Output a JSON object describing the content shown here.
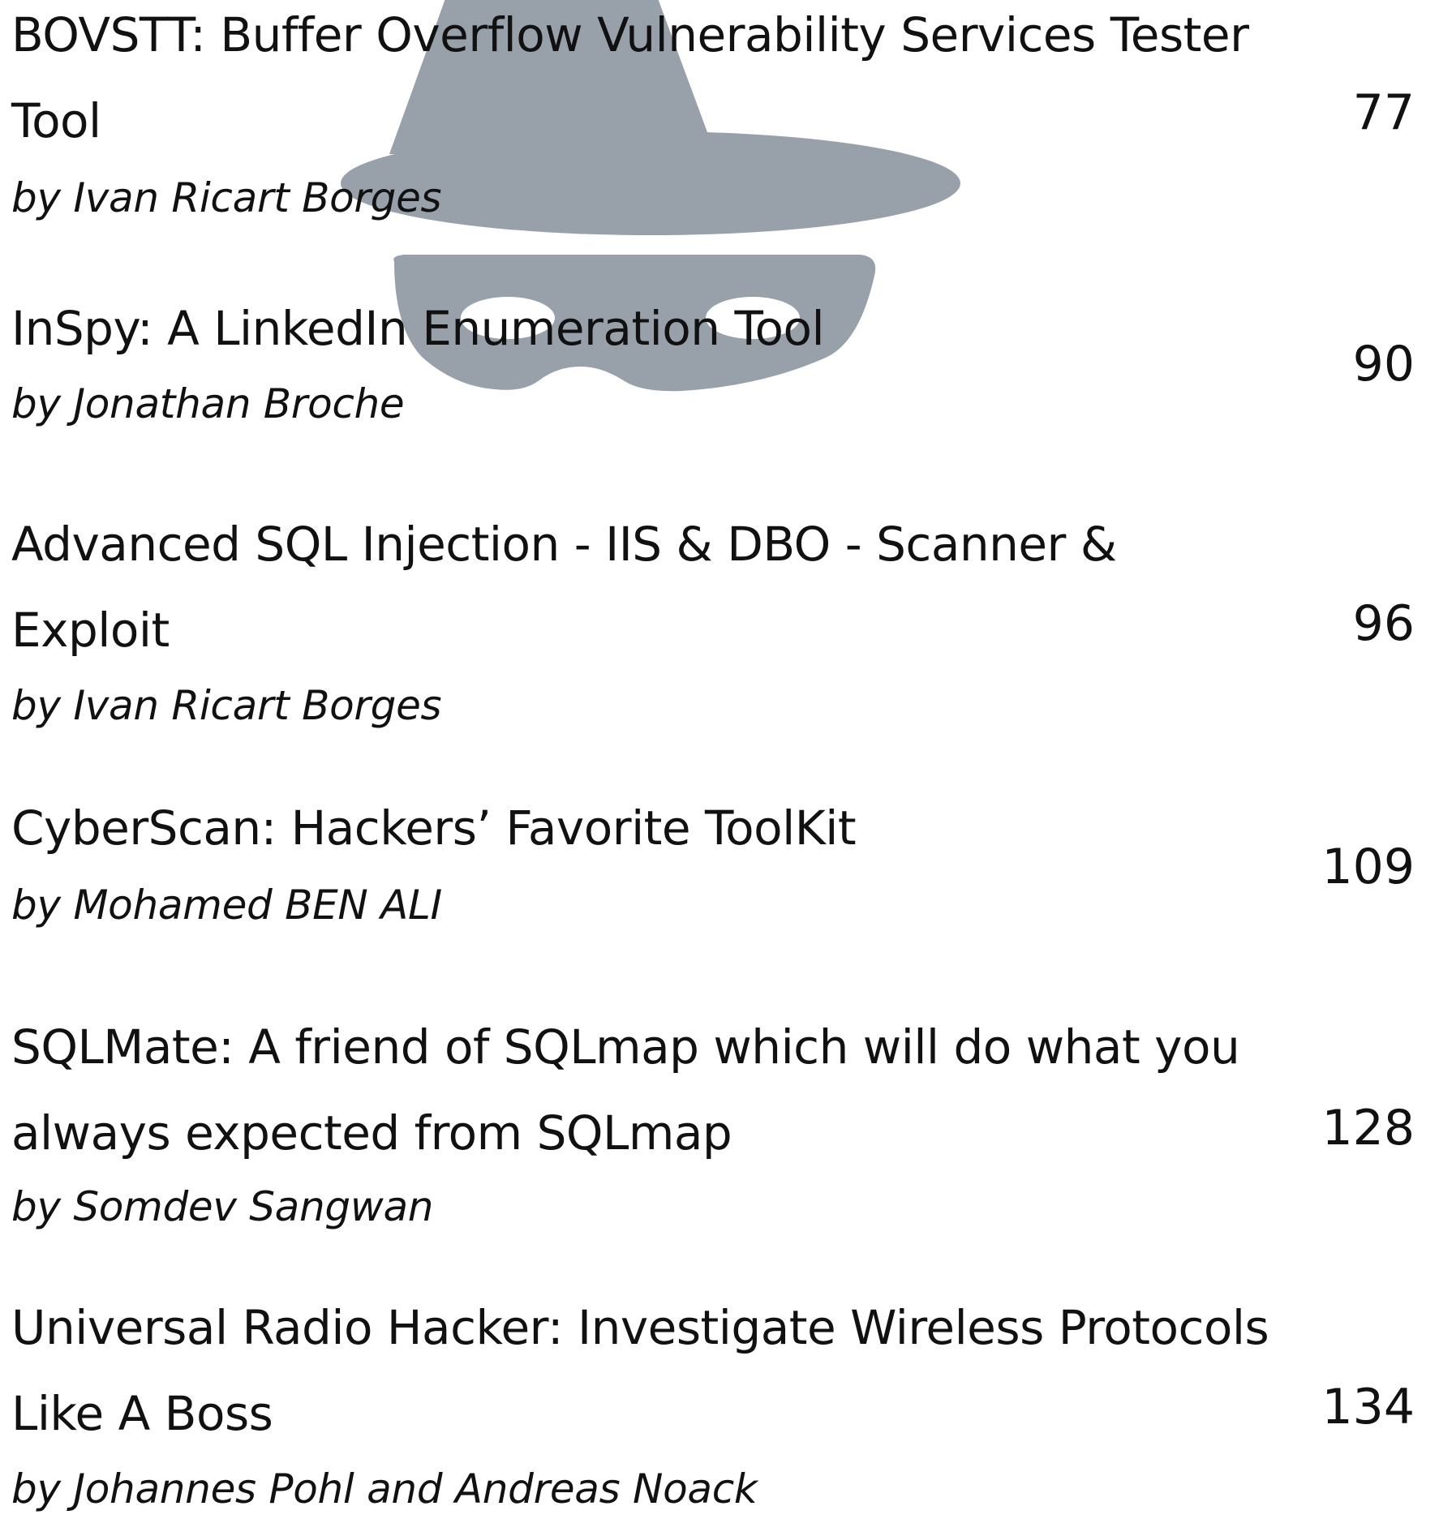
{
  "watermark": {
    "icon": "spy-hat-mask-icon",
    "color": "#98a0a9"
  },
  "entries": [
    {
      "title": "BOVSTT: Buffer Overflow Vulnerability Services Tester\nTool",
      "author": "by Ivan Ricart Borges",
      "page": "77"
    },
    {
      "title": "InSpy: A LinkedIn Enumeration Tool",
      "author": "by Jonathan Broche",
      "page": "90"
    },
    {
      "title": "Advanced SQL Injection - IIS & DBO - Scanner &\nExploit",
      "author": "by Ivan Ricart Borges",
      "page": "96"
    },
    {
      "title": "CyberScan: Hackers’ Favorite ToolKit",
      "author": "by Mohamed BEN ALI",
      "page": "109"
    },
    {
      "title": "SQLMate: A friend of SQLmap which will do what you\nalways expected from SQLmap",
      "author": "by Somdev Sangwan",
      "page": "128"
    },
    {
      "title": "Universal Radio Hacker: Investigate Wireless Protocols\nLike A Boss",
      "author": "by Johannes Pohl and Andreas Noack",
      "page": "134"
    }
  ]
}
